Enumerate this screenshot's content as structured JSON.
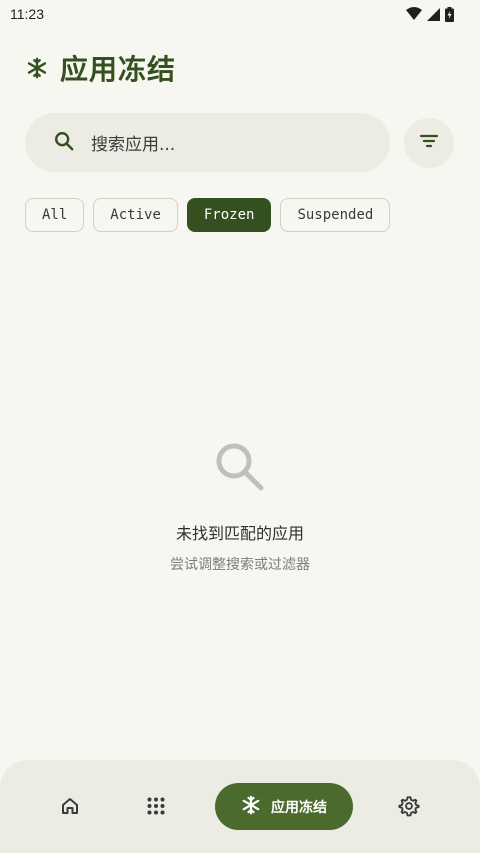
{
  "status_bar": {
    "time": "11:23",
    "icons": [
      "wifi-icon",
      "cellular-signal-icon",
      "battery-icon"
    ]
  },
  "header": {
    "title": "应用冻结",
    "icon": "snowflake-icon"
  },
  "search": {
    "placeholder": "搜索应用...",
    "icon": "search-icon"
  },
  "filter_button": {
    "icon": "filter-list-icon"
  },
  "filter_chips": [
    {
      "label": "All",
      "selected": false
    },
    {
      "label": "Active",
      "selected": false
    },
    {
      "label": "Frozen",
      "selected": true
    },
    {
      "label": "Suspended",
      "selected": false
    }
  ],
  "empty_state": {
    "icon": "search-icon",
    "title": "未找到匹配的应用",
    "subtitle": "尝试调整搜索或过滤器"
  },
  "bottom_nav": {
    "items": [
      {
        "icon": "home-icon",
        "label": "",
        "selected": false
      },
      {
        "icon": "apps-grid-icon",
        "label": "",
        "selected": false
      },
      {
        "icon": "snowflake-icon",
        "label": "应用冻结",
        "selected": true
      },
      {
        "icon": "settings-gear-icon",
        "label": "",
        "selected": false
      }
    ]
  },
  "colors": {
    "background": "#f7f7f2",
    "accent": "#35501f",
    "nav_active": "#4a6a2e",
    "surface": "#ecece4"
  }
}
